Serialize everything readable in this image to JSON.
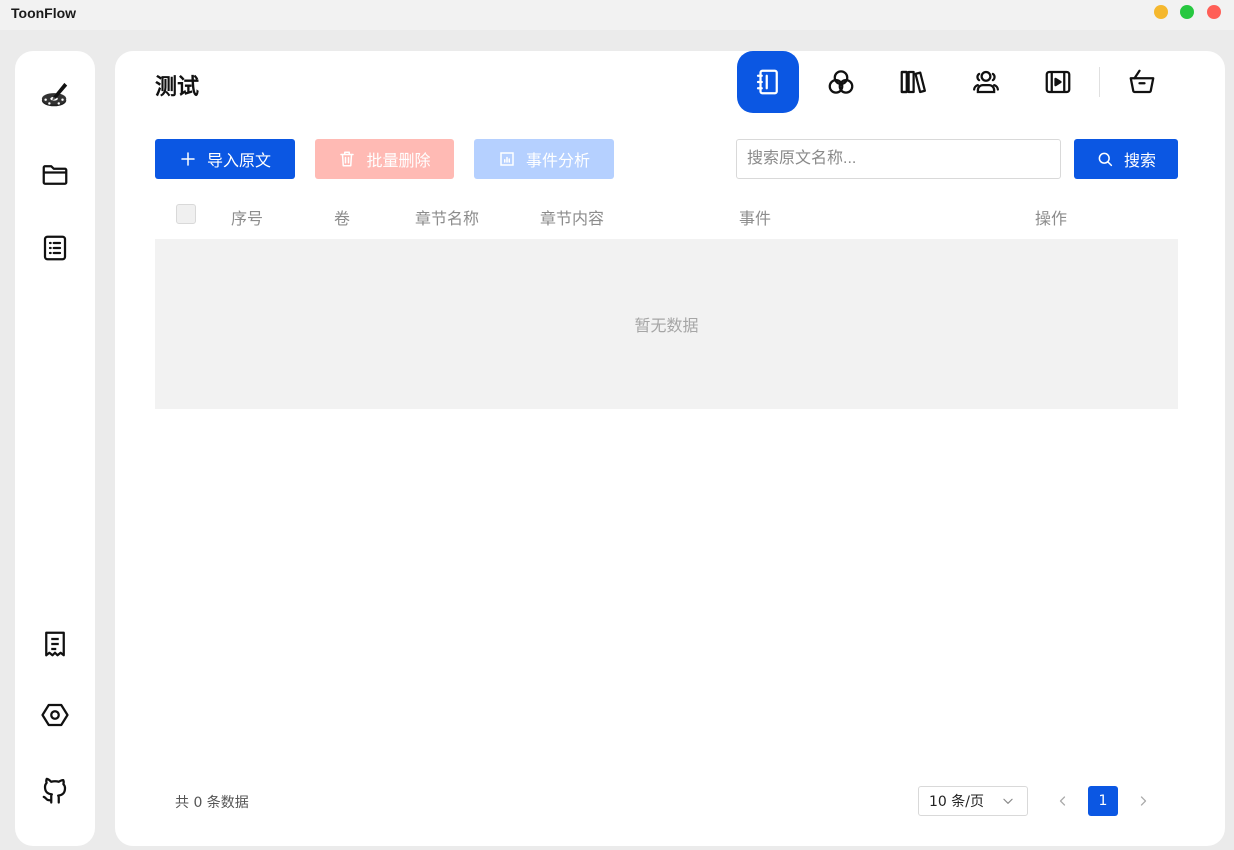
{
  "app": {
    "title": "ToonFlow"
  },
  "window_controls": [
    {
      "name": "minimize-button",
      "color": "#f5b82e"
    },
    {
      "name": "maximize-button",
      "color": "#27c840"
    },
    {
      "name": "close-button",
      "color": "#ff5f57"
    }
  ],
  "sidebar": {
    "top_items": [
      "logo-icon",
      "folder-icon",
      "list-icon"
    ],
    "bottom_items": [
      "receipt-icon",
      "settings-hexagon-icon",
      "github-icon"
    ]
  },
  "header": {
    "title": "测试",
    "tabs": [
      {
        "icon": "notebook-icon",
        "active": true
      },
      {
        "icon": "circles-icon",
        "active": false
      },
      {
        "icon": "library-icon",
        "active": false
      },
      {
        "icon": "users-icon",
        "active": false
      },
      {
        "icon": "video-icon",
        "active": false
      },
      {
        "icon": "shopping-basket-icon",
        "active": false
      }
    ]
  },
  "toolbar": {
    "import_label": "导入原文",
    "delete_label": "批量删除",
    "analyze_label": "事件分析",
    "search_placeholder": "搜索原文名称...",
    "search_label": "搜索"
  },
  "table": {
    "columns": [
      "序号",
      "卷",
      "章节名称",
      "章节内容",
      "事件",
      "操作"
    ],
    "empty_text": "暂无数据"
  },
  "pagination": {
    "total_text": "共 0 条数据",
    "page_size": "10 条/页",
    "current_page": "1"
  },
  "colors": {
    "primary": "#0b57e3",
    "danger_disabled": "#ffbab4",
    "primary_disabled": "#b5d0ff"
  }
}
